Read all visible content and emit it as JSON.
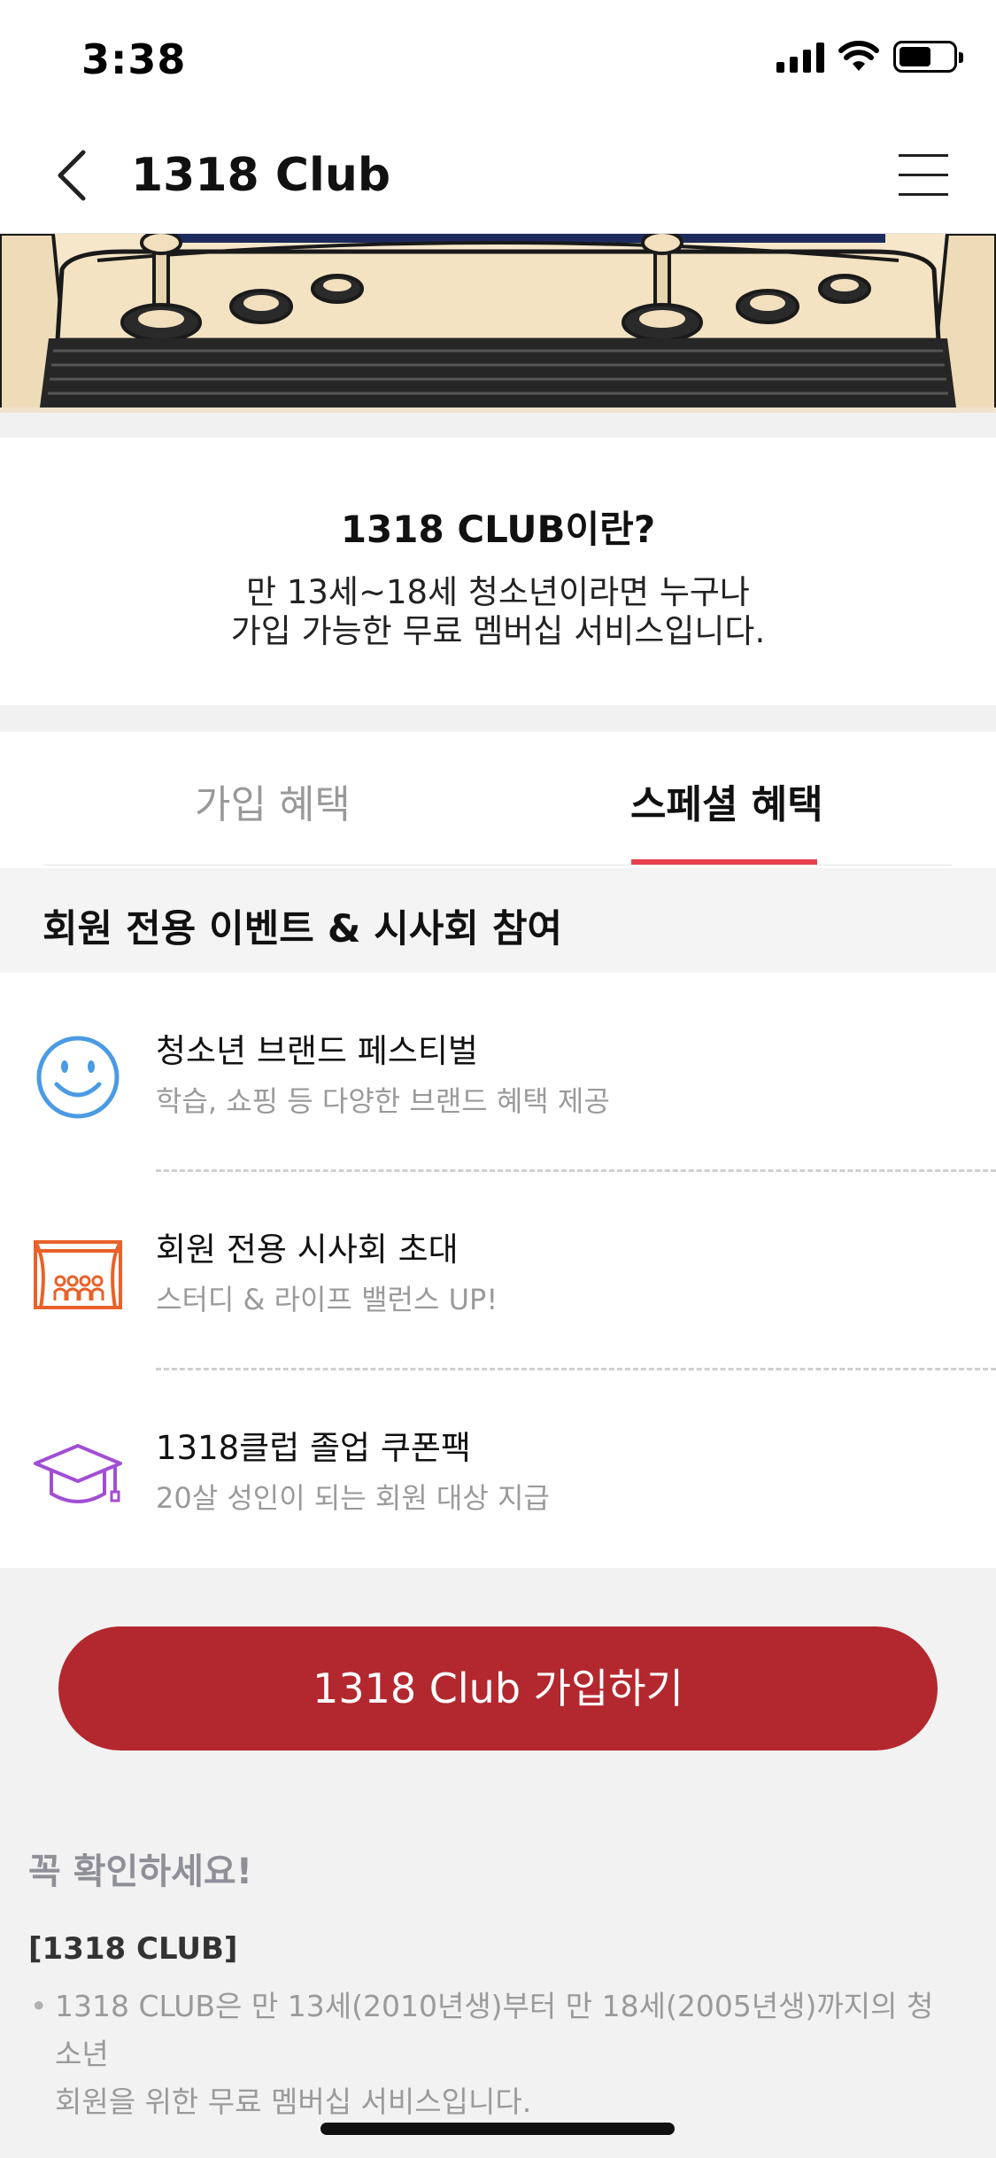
{
  "status_bar": {
    "time": "3:38",
    "icons": [
      "signal-icon",
      "wifi-icon",
      "battery-icon"
    ]
  },
  "nav": {
    "title": "1318 Club",
    "back_icon": "chevron-left-icon",
    "menu_icon": "hamburger-menu-icon"
  },
  "banner": {
    "image": "retro-arcade-console-illustration"
  },
  "intro": {
    "title": "1318 CLUB이란?",
    "desc_line1": "만 13세~18세 청소년이라면 누구나",
    "desc_line2": "가입 가능한 무료 멤버십 서비스입니다."
  },
  "tabs": [
    {
      "label": "가입 혜택",
      "selected": false
    },
    {
      "label": "스페셜 혜택",
      "selected": true
    }
  ],
  "section": {
    "title": "회원 전용 이벤트 & 시사회 참여"
  },
  "benefits": [
    {
      "icon": "smiley-face-icon",
      "title": "청소년 브랜드 페스티벌",
      "desc": "학습, 쇼핑 등 다양한 브랜드 혜택 제공"
    },
    {
      "icon": "theater-stage-icon",
      "title": "회원 전용 시사회 초대",
      "desc": "스터디 & 라이프 밸런스 UP!"
    },
    {
      "icon": "graduation-cap-icon",
      "title": "1318클럽 졸업 쿠폰팩",
      "desc": "20살 성인이 되는 회원 대상 지급"
    }
  ],
  "cta": {
    "label": "1318 Club 가입하기"
  },
  "notice": {
    "title": "꼭 확인하세요!",
    "subtitle": "[1318 CLUB]",
    "line1": "1318 CLUB은 만 13세(2010년생)부터 만 18세(2005년생)까지의 청소년",
    "line2": "회원을 위한 무료 멤버십 서비스입니다."
  },
  "colors": {
    "accent": "#b3282e",
    "tab_underline": "#e8404f",
    "smiley_icon": "#4a9be3",
    "theater_icon": "#e8622a",
    "graduation_icon": "#a24ed4"
  }
}
